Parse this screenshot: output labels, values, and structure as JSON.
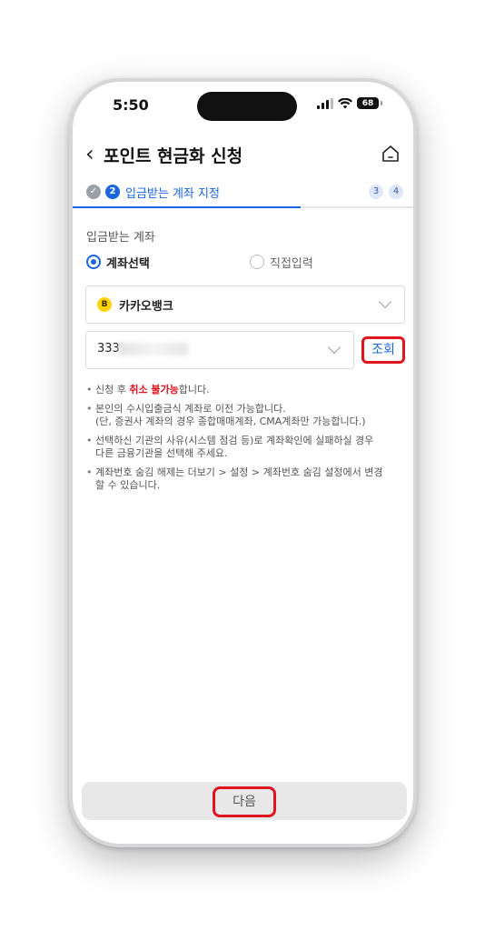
{
  "status_bar": {
    "time": "5:50",
    "battery": "68"
  },
  "header": {
    "title": "포인트 현금화 신청",
    "back_icon": "chevron-left-icon",
    "home_icon": "home-icon"
  },
  "steps": {
    "done_icon": "check-icon",
    "current_number": "2",
    "current_label": "입금받는 계좌 지정",
    "next_steps": [
      "3",
      "4"
    ],
    "progress_fraction": 0.67
  },
  "account_section": {
    "label": "입금받는 계좌",
    "radio_options": [
      {
        "label": "계좌선택",
        "selected": true
      },
      {
        "label": "직접입력",
        "selected": false
      }
    ],
    "bank": {
      "logo_letter": "B",
      "name": "카카오뱅크"
    },
    "account_number_visible": "333",
    "lookup_label": "조회"
  },
  "notes": {
    "note1_prefix": "신청 후 ",
    "note1_warn": "취소 불가능",
    "note1_suffix": "합니다.",
    "note2": "본인의 수시입출금식 계좌로 이전 가능합니다.\n(단, 증권사 계좌의 경우 종합매매계좌, CMA계좌만 가능합니다.)",
    "note3": "선택하신 기관의 사유(시스템 점검 등)로 계좌확인에 실패하실 경우\n다른 금융기관을 선택해 주세요.",
    "note4": "계좌번호 숨김 해제는 더보기 > 설정 > 계좌번호 숨김 설정에서 변경\n할 수 있습니다."
  },
  "footer": {
    "next_label": "다음"
  },
  "colors": {
    "accent": "#1a66e0",
    "highlight": "#e0141e",
    "kakao": "#ffd400"
  }
}
